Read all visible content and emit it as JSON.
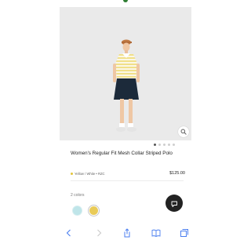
{
  "product": {
    "title": "Women's Regular Fit Mesh Collar Striped Polo",
    "variant": "Yellow / White • RZC",
    "price": "$125.00"
  },
  "carousel": {
    "count": 5,
    "active_index": 0
  },
  "colors": {
    "label": "2 colors",
    "swatches": [
      {
        "name": "light-blue",
        "color": "#bfe5e9",
        "selected": false
      },
      {
        "name": "yellow",
        "color": "#e9cb58",
        "selected": true
      }
    ]
  },
  "toolbar": {
    "icons": [
      "back-arrow-icon",
      "forward-arrow-icon",
      "share-icon",
      "bookmarks-icon",
      "tabs-icon"
    ]
  },
  "accent_colors": {
    "brand_green": "#2e7d32",
    "chat_button": "#222222",
    "shirt_yellow": "#f1e08a"
  }
}
